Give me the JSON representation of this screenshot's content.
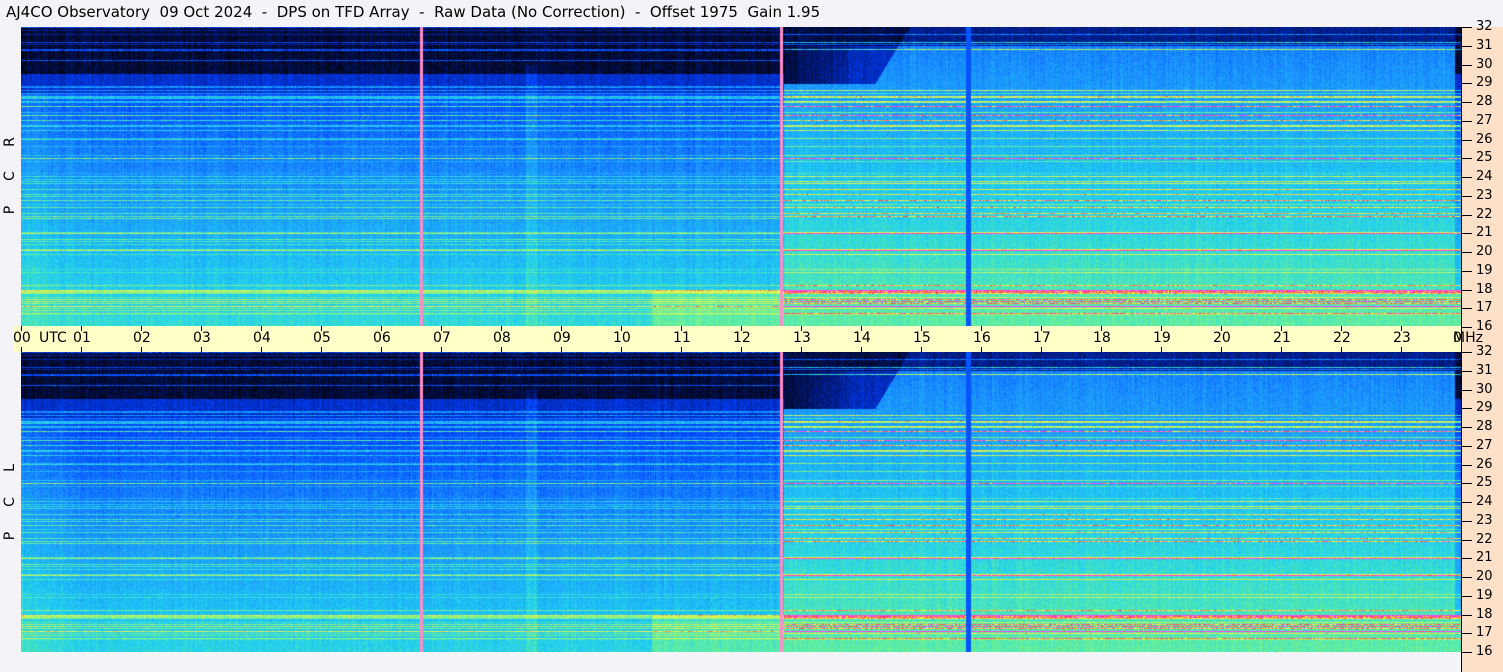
{
  "title": "AJ4CO Observatory  09 Oct 2024  -  DPS on TFD Array  -  Raw Data (No Correction)  -  Offset 1975  Gain 1.95",
  "chart_data": {
    "type": "heatmap",
    "panels": [
      {
        "ylabel": "R C P",
        "letters": [
          "R",
          "C",
          "P"
        ]
      },
      {
        "ylabel": "L C P",
        "letters": [
          "L",
          "C",
          "P"
        ]
      }
    ],
    "x_axis": {
      "unit_label": "UTC",
      "range_hours": [
        0,
        24
      ],
      "tick_labels": [
        "00",
        "01",
        "02",
        "03",
        "04",
        "05",
        "06",
        "07",
        "08",
        "09",
        "10",
        "11",
        "12",
        "13",
        "14",
        "15",
        "16",
        "17",
        "18",
        "19",
        "20",
        "21",
        "22",
        "23",
        "00"
      ]
    },
    "y_axis": {
      "unit_label": "MHz",
      "range": [
        16,
        32
      ],
      "tick_labels": [
        "32",
        "31",
        "30",
        "29",
        "28",
        "27",
        "26",
        "25",
        "24",
        "23",
        "22",
        "21",
        "20",
        "19",
        "18",
        "17",
        "16"
      ]
    },
    "colormap": [
      "#000000",
      "#001a80",
      "#0040ff",
      "#1a90ff",
      "#20d0f0",
      "#60f0a0",
      "#c0f060",
      "#ffff40",
      "#ff4040",
      "#ff40ff"
    ],
    "markers_utc": [
      6.67,
      12.67,
      15.78
    ]
  }
}
